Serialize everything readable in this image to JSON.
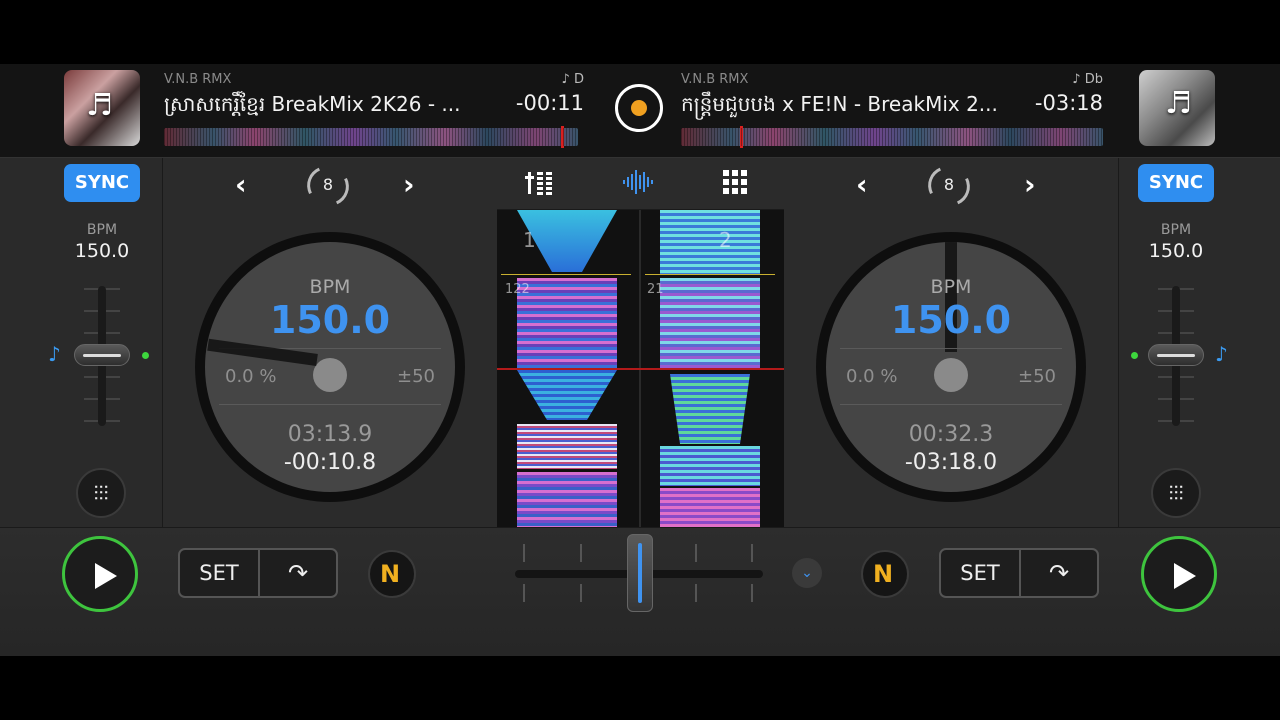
{
  "deck_a": {
    "artist": "V.N.B RMX",
    "key": "♪ D",
    "title": "ស្រាសកេរ្តិ៍ខ្មែរ BreakMix 2K26 - ...",
    "remaining_header": "-00:11",
    "sync_label": "SYNC",
    "bpm_label": "BPM",
    "bpm_value": "150.0",
    "loop_beats": "8",
    "platter": {
      "bpm_label": "BPM",
      "bpm": "150.0",
      "pitch_pct": "0.0 %",
      "pitch_range": "±50",
      "elapsed": "03:13.9",
      "remaining": "-00:10.8"
    },
    "set_label": "SET",
    "track_progress": 0.96
  },
  "deck_b": {
    "artist": "V.N.B RMX",
    "key": "♪ Db",
    "title": "កន្ត្រឹមជួបបង x FE!N - BreakMix 2...",
    "remaining_header": "-03:18",
    "sync_label": "SYNC",
    "bpm_label": "BPM",
    "bpm_value": "150.0",
    "loop_beats": "8",
    "platter": {
      "bpm_label": "BPM",
      "bpm": "150.0",
      "pitch_pct": "0.0 %",
      "pitch_range": "±50",
      "elapsed": "00:32.3",
      "remaining": "-03:18.0"
    },
    "set_label": "SET",
    "track_progress": 0.14
  },
  "center": {
    "tabs": [
      "mixer-icon",
      "waveform-icon",
      "pads-grid-icon"
    ],
    "active_tab": "waveform",
    "deck_a_marker": "1",
    "deck_b_marker": "2",
    "deck_a_beat_label": "122",
    "deck_b_beat_label": "21"
  },
  "icons": {
    "music_note": "♬",
    "keylock": "♪",
    "chevron_left": "‹",
    "chevron_right": "›",
    "eq": "⫶",
    "jump": "↷",
    "n_letter": "N",
    "menu_chevron": "⌄"
  },
  "colors": {
    "accent_blue": "#3f93f0",
    "play_green": "#3ec43e",
    "record_orange": "#f0a020",
    "playhead_red": "#e22222"
  },
  "crossfader_position": 0.5
}
